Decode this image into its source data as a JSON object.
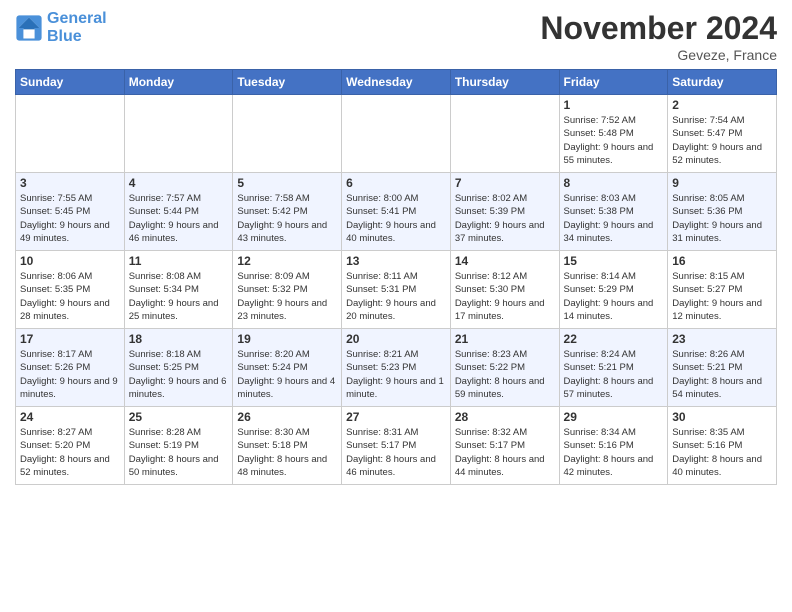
{
  "header": {
    "logo_line1": "General",
    "logo_line2": "Blue",
    "month": "November 2024",
    "location": "Geveze, France"
  },
  "weekdays": [
    "Sunday",
    "Monday",
    "Tuesday",
    "Wednesday",
    "Thursday",
    "Friday",
    "Saturday"
  ],
  "weeks": [
    [
      {
        "day": "",
        "info": ""
      },
      {
        "day": "",
        "info": ""
      },
      {
        "day": "",
        "info": ""
      },
      {
        "day": "",
        "info": ""
      },
      {
        "day": "",
        "info": ""
      },
      {
        "day": "1",
        "info": "Sunrise: 7:52 AM\nSunset: 5:48 PM\nDaylight: 9 hours and 55 minutes."
      },
      {
        "day": "2",
        "info": "Sunrise: 7:54 AM\nSunset: 5:47 PM\nDaylight: 9 hours and 52 minutes."
      }
    ],
    [
      {
        "day": "3",
        "info": "Sunrise: 7:55 AM\nSunset: 5:45 PM\nDaylight: 9 hours and 49 minutes."
      },
      {
        "day": "4",
        "info": "Sunrise: 7:57 AM\nSunset: 5:44 PM\nDaylight: 9 hours and 46 minutes."
      },
      {
        "day": "5",
        "info": "Sunrise: 7:58 AM\nSunset: 5:42 PM\nDaylight: 9 hours and 43 minutes."
      },
      {
        "day": "6",
        "info": "Sunrise: 8:00 AM\nSunset: 5:41 PM\nDaylight: 9 hours and 40 minutes."
      },
      {
        "day": "7",
        "info": "Sunrise: 8:02 AM\nSunset: 5:39 PM\nDaylight: 9 hours and 37 minutes."
      },
      {
        "day": "8",
        "info": "Sunrise: 8:03 AM\nSunset: 5:38 PM\nDaylight: 9 hours and 34 minutes."
      },
      {
        "day": "9",
        "info": "Sunrise: 8:05 AM\nSunset: 5:36 PM\nDaylight: 9 hours and 31 minutes."
      }
    ],
    [
      {
        "day": "10",
        "info": "Sunrise: 8:06 AM\nSunset: 5:35 PM\nDaylight: 9 hours and 28 minutes."
      },
      {
        "day": "11",
        "info": "Sunrise: 8:08 AM\nSunset: 5:34 PM\nDaylight: 9 hours and 25 minutes."
      },
      {
        "day": "12",
        "info": "Sunrise: 8:09 AM\nSunset: 5:32 PM\nDaylight: 9 hours and 23 minutes."
      },
      {
        "day": "13",
        "info": "Sunrise: 8:11 AM\nSunset: 5:31 PM\nDaylight: 9 hours and 20 minutes."
      },
      {
        "day": "14",
        "info": "Sunrise: 8:12 AM\nSunset: 5:30 PM\nDaylight: 9 hours and 17 minutes."
      },
      {
        "day": "15",
        "info": "Sunrise: 8:14 AM\nSunset: 5:29 PM\nDaylight: 9 hours and 14 minutes."
      },
      {
        "day": "16",
        "info": "Sunrise: 8:15 AM\nSunset: 5:27 PM\nDaylight: 9 hours and 12 minutes."
      }
    ],
    [
      {
        "day": "17",
        "info": "Sunrise: 8:17 AM\nSunset: 5:26 PM\nDaylight: 9 hours and 9 minutes."
      },
      {
        "day": "18",
        "info": "Sunrise: 8:18 AM\nSunset: 5:25 PM\nDaylight: 9 hours and 6 minutes."
      },
      {
        "day": "19",
        "info": "Sunrise: 8:20 AM\nSunset: 5:24 PM\nDaylight: 9 hours and 4 minutes."
      },
      {
        "day": "20",
        "info": "Sunrise: 8:21 AM\nSunset: 5:23 PM\nDaylight: 9 hours and 1 minute."
      },
      {
        "day": "21",
        "info": "Sunrise: 8:23 AM\nSunset: 5:22 PM\nDaylight: 8 hours and 59 minutes."
      },
      {
        "day": "22",
        "info": "Sunrise: 8:24 AM\nSunset: 5:21 PM\nDaylight: 8 hours and 57 minutes."
      },
      {
        "day": "23",
        "info": "Sunrise: 8:26 AM\nSunset: 5:21 PM\nDaylight: 8 hours and 54 minutes."
      }
    ],
    [
      {
        "day": "24",
        "info": "Sunrise: 8:27 AM\nSunset: 5:20 PM\nDaylight: 8 hours and 52 minutes."
      },
      {
        "day": "25",
        "info": "Sunrise: 8:28 AM\nSunset: 5:19 PM\nDaylight: 8 hours and 50 minutes."
      },
      {
        "day": "26",
        "info": "Sunrise: 8:30 AM\nSunset: 5:18 PM\nDaylight: 8 hours and 48 minutes."
      },
      {
        "day": "27",
        "info": "Sunrise: 8:31 AM\nSunset: 5:17 PM\nDaylight: 8 hours and 46 minutes."
      },
      {
        "day": "28",
        "info": "Sunrise: 8:32 AM\nSunset: 5:17 PM\nDaylight: 8 hours and 44 minutes."
      },
      {
        "day": "29",
        "info": "Sunrise: 8:34 AM\nSunset: 5:16 PM\nDaylight: 8 hours and 42 minutes."
      },
      {
        "day": "30",
        "info": "Sunrise: 8:35 AM\nSunset: 5:16 PM\nDaylight: 8 hours and 40 minutes."
      }
    ]
  ]
}
